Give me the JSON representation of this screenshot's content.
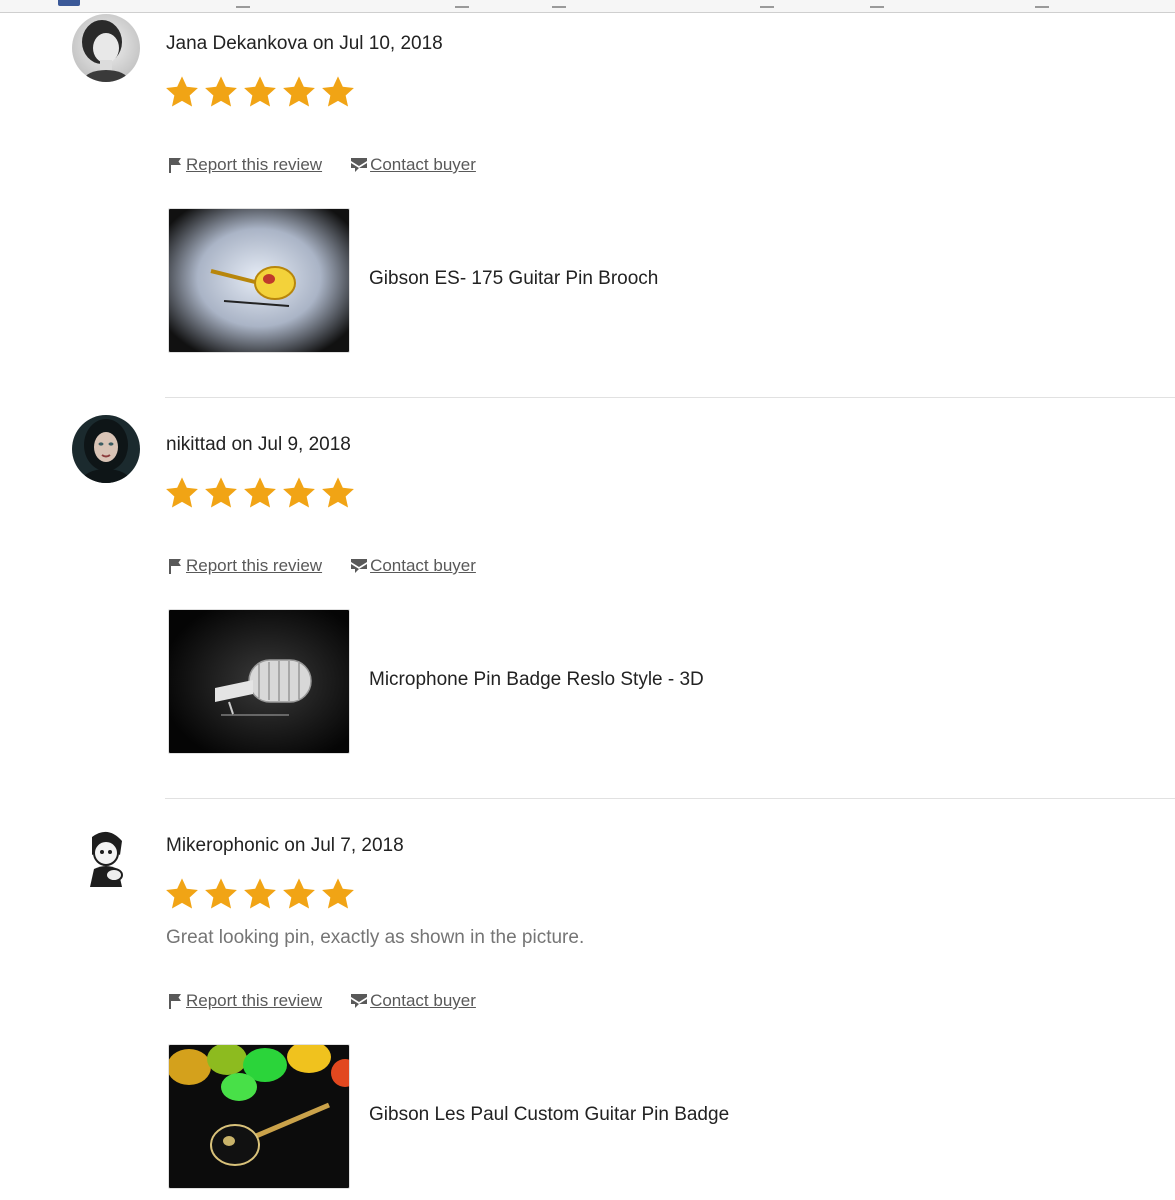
{
  "colors": {
    "star": "#F1A415",
    "link": "#595959",
    "muted": "#757575",
    "divider": "#E1E1E1"
  },
  "icons": {
    "rating": "star-icon",
    "report": "flag-icon",
    "contact": "message-icon"
  },
  "reviews": [
    {
      "reviewer": "Jana Dekankova on Jul 10, 2018",
      "rating": 5,
      "comment": "",
      "report_label": "Report this review",
      "contact_label": "Contact buyer",
      "product": "Gibson ES- 175 Guitar Pin Brooch"
    },
    {
      "reviewer": "nikittad on Jul 9, 2018",
      "rating": 5,
      "comment": "",
      "report_label": "Report this review",
      "contact_label": "Contact buyer",
      "product": "Microphone Pin Badge Reslo Style - 3D"
    },
    {
      "reviewer": "Mikerophonic on Jul 7, 2018",
      "rating": 5,
      "comment": "Great looking pin, exactly as shown in the picture.",
      "report_label": "Report this review",
      "contact_label": "Contact buyer",
      "product": "Gibson Les Paul Custom Guitar Pin Badge"
    }
  ]
}
